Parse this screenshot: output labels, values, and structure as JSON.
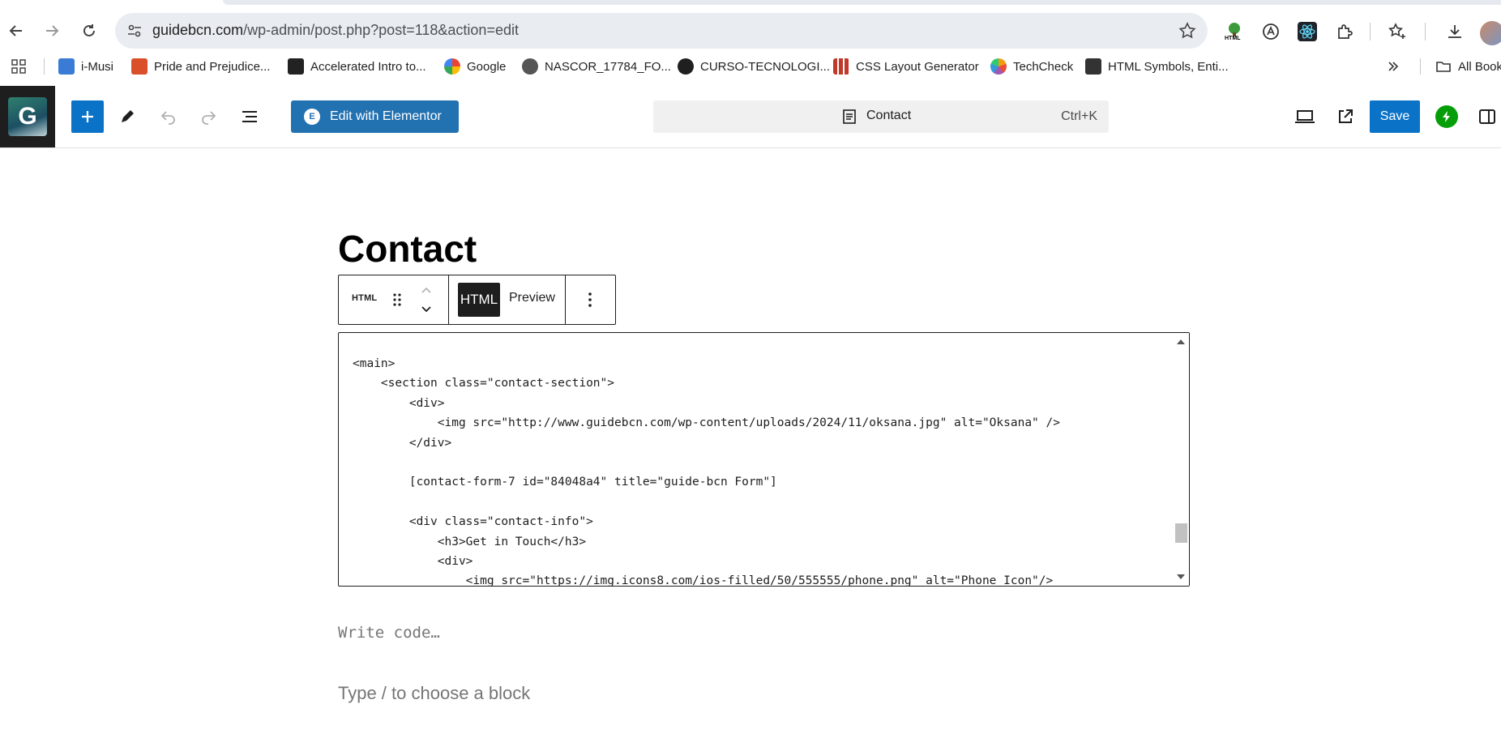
{
  "browser": {
    "url_host": "guidebcn.com",
    "url_path": "/wp-admin/post.php?post=118&action=edit",
    "bookmarks": [
      {
        "label": "i-Musi",
        "color": "#3a7bd5"
      },
      {
        "label": "Pride and Prejudice...",
        "color": "#d9502a"
      },
      {
        "label": "Accelerated Intro to...",
        "color": "#222222"
      },
      {
        "label": "Google",
        "color": "#4285f4"
      },
      {
        "label": "NASCOR_17784_FO...",
        "color": "#555555"
      },
      {
        "label": "CURSO-TECNOLOGI...",
        "color": "#1f1f1f"
      },
      {
        "label": "CSS Layout Generator",
        "color": "#c0392b"
      },
      {
        "label": "TechCheck",
        "color": "#f39c12"
      },
      {
        "label": "HTML Symbols, Enti...",
        "color": "#333333"
      }
    ],
    "all_bookmarks": "All Book",
    "extension_html_label": "HTML"
  },
  "editor": {
    "edit_with_elementor": "Edit with Elementor",
    "elementor_glyph": "E",
    "document_title": "Contact",
    "shortcut": "Ctrl+K",
    "save": "Save",
    "logo_letter": "G"
  },
  "content": {
    "post_title": "Contact",
    "block_type_label": "HTML",
    "tab_html": "HTML",
    "tab_preview": "Preview",
    "code_lines": [
      "<main>",
      "    <section class=\"contact-section\">",
      "        <div>",
      "            <img src=\"http://www.guidebcn.com/wp-content/uploads/2024/11/oksana.jpg\" alt=\"Oksana\" />",
      "        </div>",
      "",
      "        [contact-form-7 id=\"84048a4\" title=\"guide-bcn Form\"]",
      "",
      "        <div class=\"contact-info\">",
      "            <h3>Get in Touch</h3>",
      "            <div>",
      "                <img src=\"https://img.icons8.com/ios-filled/50/555555/phone.png\" alt=\"Phone Icon\"/>"
    ],
    "write_code_placeholder": "Write code…",
    "type_block_placeholder": "Type / to choose a block"
  },
  "colors": {
    "wp_blue": "#0a73c8",
    "elementor_blue": "#2271b1",
    "jetpack_green": "#069e08"
  }
}
